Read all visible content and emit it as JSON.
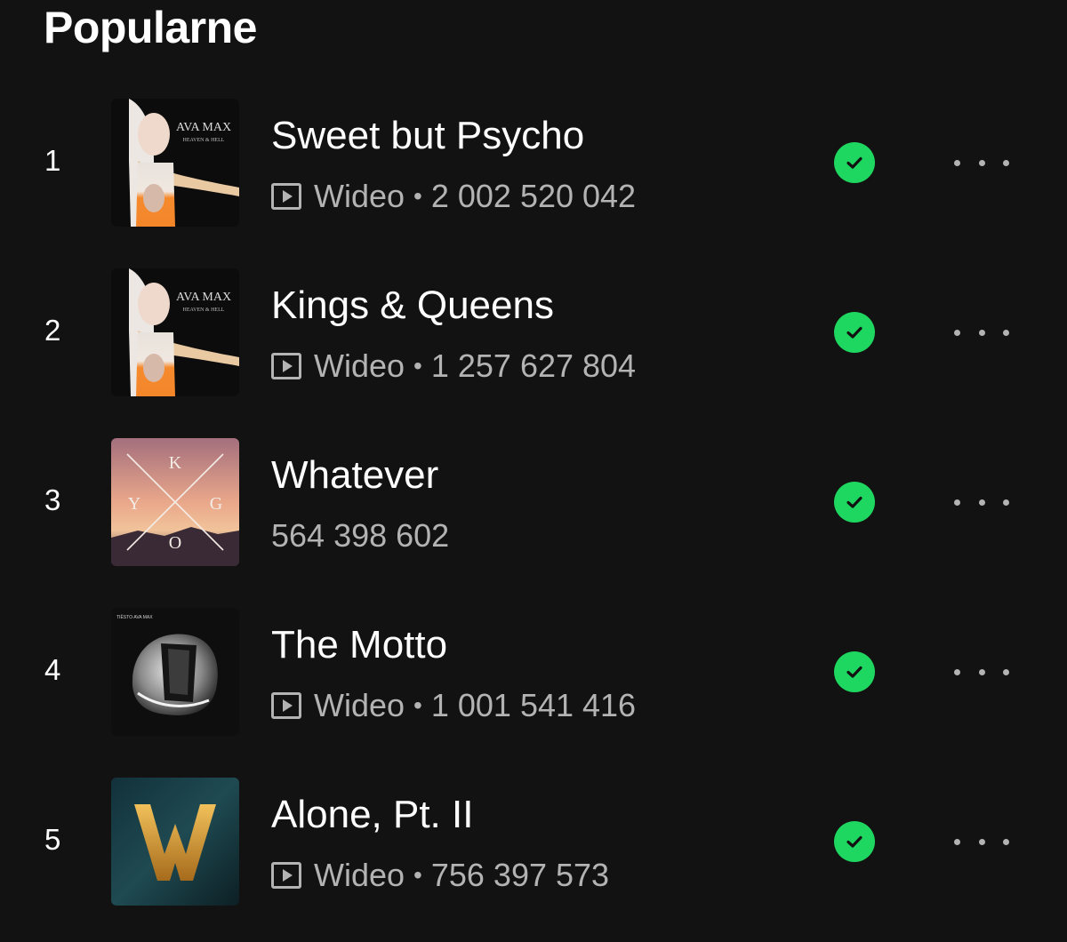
{
  "section": {
    "title": "Popularne"
  },
  "colors": {
    "accent": "#1ed760",
    "background": "#121212",
    "secondary_text": "#b3b3b3"
  },
  "tracks": [
    {
      "rank": "1",
      "title": "Sweet but Psycho",
      "has_video": true,
      "video_label": "Wideo",
      "separator": "•",
      "plays": "2 002 520 042",
      "saved": true,
      "cover_text": "AVA MAX",
      "cover_subtext": "HEAVEN & HELL"
    },
    {
      "rank": "2",
      "title": "Kings & Queens",
      "has_video": true,
      "video_label": "Wideo",
      "separator": "•",
      "plays": "1 257 627 804",
      "saved": true,
      "cover_text": "AVA MAX",
      "cover_subtext": "HEAVEN & HELL"
    },
    {
      "rank": "3",
      "title": "Whatever",
      "has_video": false,
      "plays": "564 398 602",
      "saved": true,
      "cover_letters": [
        "K",
        "Y",
        "G",
        "O"
      ]
    },
    {
      "rank": "4",
      "title": "The Motto",
      "has_video": true,
      "video_label": "Wideo",
      "separator": "•",
      "plays": "1 001 541 416",
      "saved": true,
      "cover_text": "TIËSTO∙AVA MAX"
    },
    {
      "rank": "5",
      "title": "Alone, Pt. II",
      "has_video": true,
      "video_label": "Wideo",
      "separator": "•",
      "plays": "756 397 573",
      "saved": true
    }
  ]
}
